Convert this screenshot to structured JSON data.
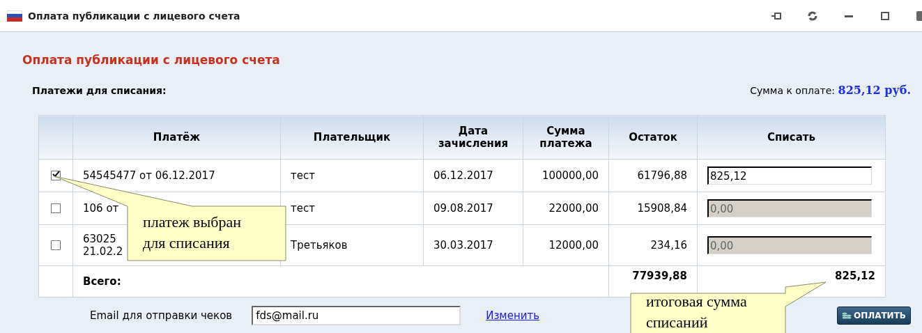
{
  "window": {
    "title": "Оплата публикации с лицевого счета"
  },
  "heading": "Оплата публикации с лицевого счета",
  "section_label": "Платежи для списания:",
  "amount_due": {
    "label": "Сумма к оплате:",
    "value": "825,12 руб."
  },
  "table": {
    "columns": [
      [
        "Платёж"
      ],
      [
        "Плательщик"
      ],
      [
        "Дата",
        "зачисления"
      ],
      [
        "Сумма",
        "платежа"
      ],
      [
        "Остаток"
      ],
      [
        "Списать"
      ]
    ],
    "rows": [
      {
        "checked": true,
        "payment": [
          "54545477 от 06.12.2017"
        ],
        "payer": "тест",
        "date": "06.12.2017",
        "amount": "100000,00",
        "balance": "61796,88",
        "write_off": "825,12",
        "disabled": false
      },
      {
        "checked": false,
        "payment": [
          "106 от"
        ],
        "payer": "тест",
        "date": "09.08.2017",
        "amount": "22000,00",
        "balance": "15908,84",
        "write_off": "0,00",
        "disabled": true
      },
      {
        "checked": false,
        "payment": [
          "63025",
          "21.02.2"
        ],
        "payer": "Третьяков",
        "date": "30.03.2017",
        "amount": "12000,00",
        "balance": "234,16",
        "write_off": "0,00",
        "disabled": true
      }
    ],
    "total": {
      "label": "Всего:",
      "balance": "77939,88",
      "write_off": "825,12"
    }
  },
  "email": {
    "label": "Email для отправки чеков",
    "value": "fds@mail.ru"
  },
  "change_link": "Изменить",
  "pay_button": "ОПЛАТИТЬ",
  "callouts": [
    {
      "lines": [
        "платеж выбран",
        "для списания"
      ]
    },
    {
      "lines": [
        "итоговая сумма",
        "списаний"
      ]
    }
  ]
}
